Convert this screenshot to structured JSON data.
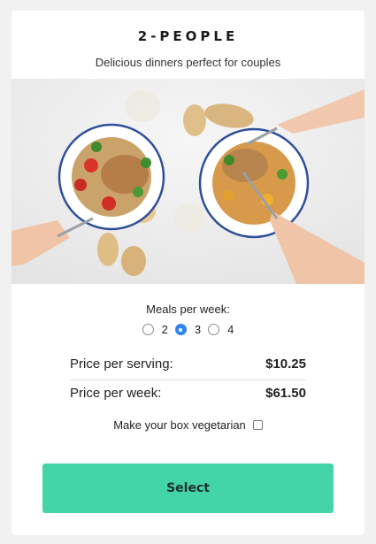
{
  "plan": {
    "title": "2-PEOPLE",
    "subtitle": "Delicious dinners perfect for couples"
  },
  "meals": {
    "label": "Meals per week:",
    "options": [
      "2",
      "3",
      "4"
    ],
    "selected": "3"
  },
  "pricing": {
    "per_serving_label": "Price per serving:",
    "per_serving_value": "$10.25",
    "per_week_label": "Price per week:",
    "per_week_value": "$61.50"
  },
  "vegetarian": {
    "label": "Make your box vegetarian",
    "checked": false
  },
  "select_button": {
    "label": "Select",
    "color": "#43d5a6"
  },
  "colors": {
    "radio_selected": "#2f86ea",
    "background": "#f1f1f1"
  }
}
